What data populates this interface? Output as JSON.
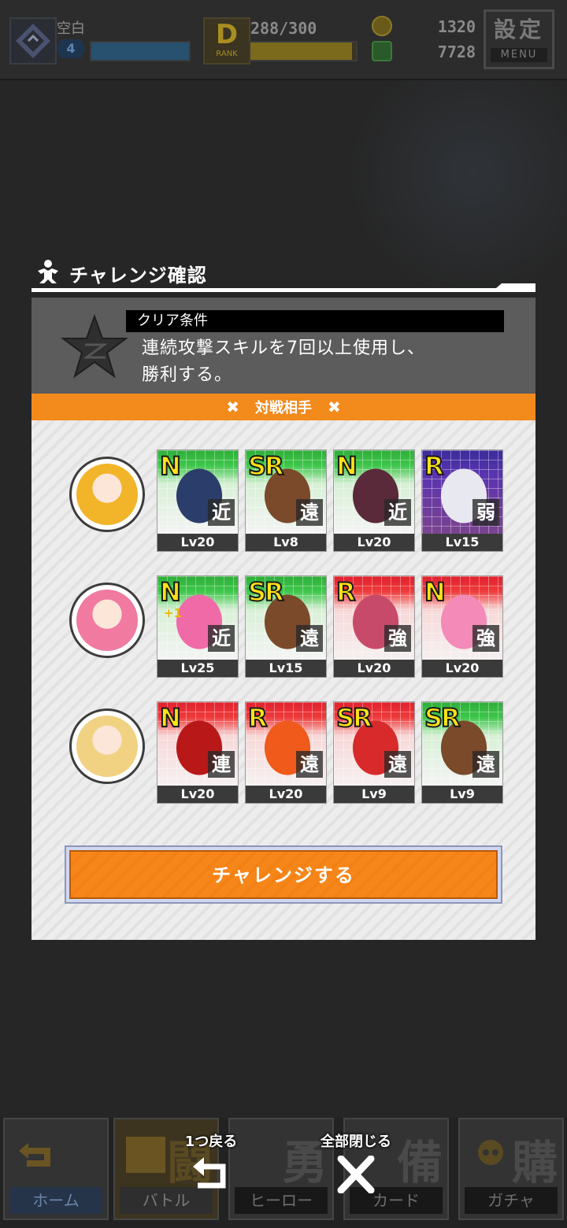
{
  "header": {
    "player_name": "空白",
    "player_level": "4",
    "player_exp_fraction": 1.0,
    "rank_letter": "D",
    "rank_label": "RANK",
    "stamina_text": "288/300",
    "stamina_fraction": 0.96,
    "coins": "1320",
    "gems": "7728",
    "menu_kanji": "設定",
    "menu_label": "MENU"
  },
  "dialog": {
    "title": "チャレンジ確認",
    "clear_condition_label": "クリア条件",
    "clear_condition_line1": "連続攻撃スキルを7回以上使用し、",
    "clear_condition_line2": "勝利する。",
    "opponents_label": "対戦相手",
    "opponents_deco": "✖",
    "challenge_button": "チャレンジする"
  },
  "opponents": [
    {
      "avatar": "headphone-boy",
      "cards": [
        {
          "rarity": "N",
          "type": "近",
          "level": "Lv20",
          "plus": "",
          "color": "green",
          "figure": "police-officer"
        },
        {
          "rarity": "SR",
          "type": "遠",
          "level": "Lv8",
          "plus": "",
          "color": "green",
          "figure": "gunman"
        },
        {
          "rarity": "N",
          "type": "近",
          "level": "Lv20",
          "plus": "",
          "color": "green",
          "figure": "plant-bike"
        },
        {
          "rarity": "R",
          "type": "弱",
          "level": "Lv15",
          "plus": "",
          "color": "purple",
          "figure": "ghost"
        }
      ]
    },
    {
      "avatar": "pink-hair-girl",
      "cards": [
        {
          "rarity": "N",
          "type": "近",
          "level": "Lv25",
          "plus": "+1",
          "color": "green",
          "figure": "magic-wand"
        },
        {
          "rarity": "SR",
          "type": "遠",
          "level": "Lv15",
          "plus": "",
          "color": "green",
          "figure": "gunman"
        },
        {
          "rarity": "R",
          "type": "強",
          "level": "Lv20",
          "plus": "",
          "color": "red",
          "figure": "heart-key"
        },
        {
          "rarity": "N",
          "type": "強",
          "level": "Lv20",
          "plus": "",
          "color": "red",
          "figure": "umbrella"
        }
      ]
    },
    {
      "avatar": "blonde-girl",
      "cards": [
        {
          "rarity": "N",
          "type": "連",
          "level": "Lv20",
          "plus": "",
          "color": "red",
          "figure": "firecrackers"
        },
        {
          "rarity": "R",
          "type": "遠",
          "level": "Lv20",
          "plus": "",
          "color": "red",
          "figure": "fire-hand"
        },
        {
          "rarity": "SR",
          "type": "遠",
          "level": "Lv9",
          "plus": "",
          "color": "red",
          "figure": "skull-dancer"
        },
        {
          "rarity": "SR",
          "type": "遠",
          "level": "Lv9",
          "plus": "",
          "color": "green",
          "figure": "gunman"
        }
      ]
    }
  ],
  "bottom_nav": {
    "home": {
      "label": "ホーム"
    },
    "battle": {
      "big": "闘",
      "label": "バトル"
    },
    "hero": {
      "big": "勇",
      "label": "ヒーロー"
    },
    "card": {
      "big": "備",
      "label": "カード"
    },
    "gacha": {
      "big": "購",
      "label": "ガチャ"
    }
  },
  "overlay": {
    "back_label": "1つ戻る",
    "close_all_label": "全部閉じる"
  },
  "colors": {
    "accent_orange": "#f28a1c",
    "card_green": "#2fae3a",
    "card_red": "#e0212e",
    "card_purple": "#4a2c9a",
    "rarity_yellow": "#ffe316"
  }
}
